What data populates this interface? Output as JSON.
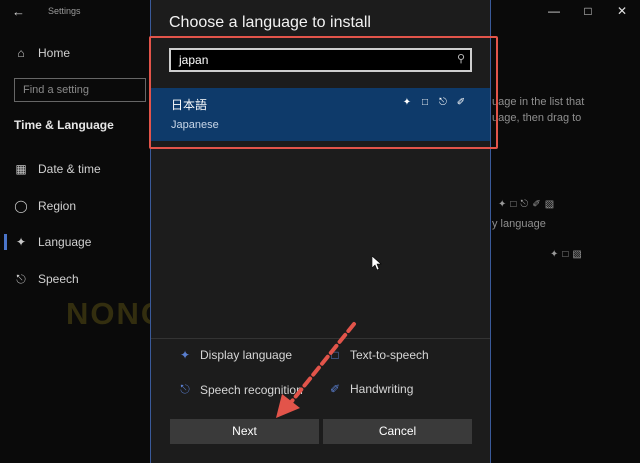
{
  "settings": {
    "title": "Settings",
    "search_placeholder": "Find a setting",
    "section": "Time & Language",
    "nav": [
      {
        "label": "Home",
        "icon": "home-icon"
      },
      {
        "label": "Date & time",
        "icon": "calendar-clock-icon"
      },
      {
        "label": "Region",
        "icon": "globe-icon"
      },
      {
        "label": "Language",
        "icon": "language-icon"
      },
      {
        "label": "Speech",
        "icon": "microphone-icon"
      }
    ],
    "right_text_1": "uage in the list that",
    "right_text_2": "uage, then drag to",
    "right_text_3": "y language"
  },
  "dialog": {
    "title": "Choose a language to install",
    "search_value": "japan",
    "result": {
      "native": "日本語",
      "english": "Japanese"
    },
    "legend": [
      {
        "label": "Display language",
        "icon": "display-language-icon"
      },
      {
        "label": "Text-to-speech",
        "icon": "text-to-speech-icon"
      },
      {
        "label": "Speech recognition",
        "icon": "speech-recognition-icon"
      },
      {
        "label": "Handwriting",
        "icon": "handwriting-icon"
      }
    ],
    "buttons": {
      "next": "Next",
      "cancel": "Cancel"
    }
  },
  "watermark": "NONGIT.COM",
  "colors": {
    "accent": "#0e3a6a",
    "highlight_box": "#e2544a",
    "arrow": "#e2544a"
  }
}
